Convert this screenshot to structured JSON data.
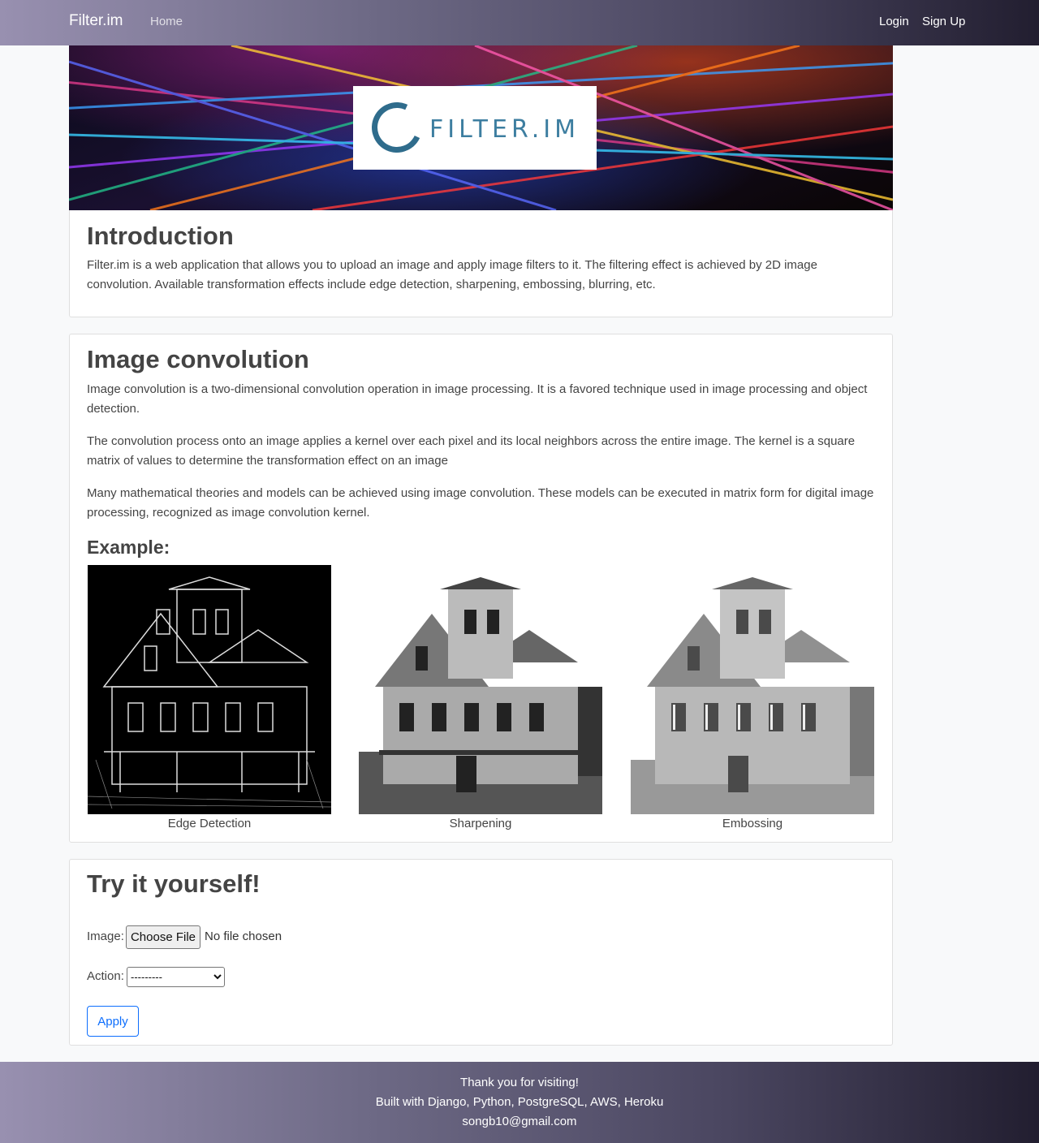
{
  "nav": {
    "brand": "Filter.im",
    "home": "Home",
    "login": "Login",
    "signup": "Sign Up"
  },
  "hero": {
    "logo_text": "FILTER.IM"
  },
  "intro": {
    "title": "Introduction",
    "text": "Filter.im is a web application that allows you to upload an image and apply image filters to it. The filtering effect is achieved by 2D image convolution. Available transformation effects include edge detection, sharpening, embossing, blurring, etc."
  },
  "convolution": {
    "title": "Image convolution",
    "paragraphs": [
      "Image convolution is a two-dimensional convolution operation in image processing. It is a favored technique used in image processing and object detection.",
      "The convolution process onto an image applies a kernel over each pixel and its local neighbors across the entire image. The kernel is a square matrix of values to determine the transformation effect on an image",
      "Many mathematical theories and models can be achieved using image convolution. These models can be executed in matrix form for digital image processing, recognized as image convolution kernel."
    ],
    "example_title": "Example:",
    "examples": [
      {
        "caption": "Edge Detection"
      },
      {
        "caption": "Sharpening"
      },
      {
        "caption": "Embossing"
      }
    ]
  },
  "try": {
    "title": "Try it yourself!",
    "image_label": "Image:",
    "file_button": "Choose File",
    "file_status": "No file chosen",
    "action_label": "Action:",
    "action_selected": "---------",
    "apply": "Apply"
  },
  "footer": {
    "line1": "Thank you for visiting!",
    "line2": "Built with Django, Python, PostgreSQL, AWS, Heroku",
    "line3": "songb10@gmail.com"
  },
  "colors": {
    "accent": "#0d6efd",
    "logo": "#2f6c8c"
  }
}
